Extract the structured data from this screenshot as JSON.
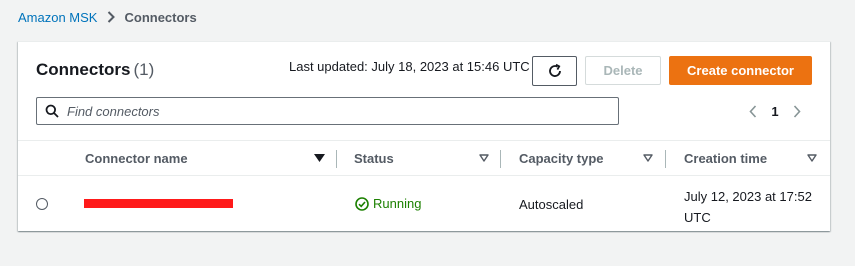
{
  "breadcrumb": {
    "root": "Amazon MSK",
    "current": "Connectors"
  },
  "panel": {
    "title": "Connectors",
    "count": "(1)",
    "last_updated": "Last updated: July 18, 2023 at 15:46 UTC",
    "delete_label": "Delete",
    "create_label": "Create connector"
  },
  "search": {
    "placeholder": "Find connectors"
  },
  "pagination": {
    "current_page": "1"
  },
  "table": {
    "columns": [
      "Connector name",
      "Status",
      "Capacity type",
      "Creation time"
    ],
    "rows": [
      {
        "status": "Running",
        "capacity": "Autoscaled",
        "created_line1": "July 12, 2023 at 17:52",
        "created_line2": "UTC"
      }
    ]
  },
  "colors": {
    "accent": "#ec7211",
    "link": "#0073bb",
    "success": "#1d8102",
    "redaction": "#ff1a1a"
  },
  "icons": [
    "chevron-right-icon",
    "refresh-icon",
    "search-icon",
    "chevron-left-icon",
    "sort-descending-icon",
    "sort-icon",
    "status-success-icon"
  ]
}
